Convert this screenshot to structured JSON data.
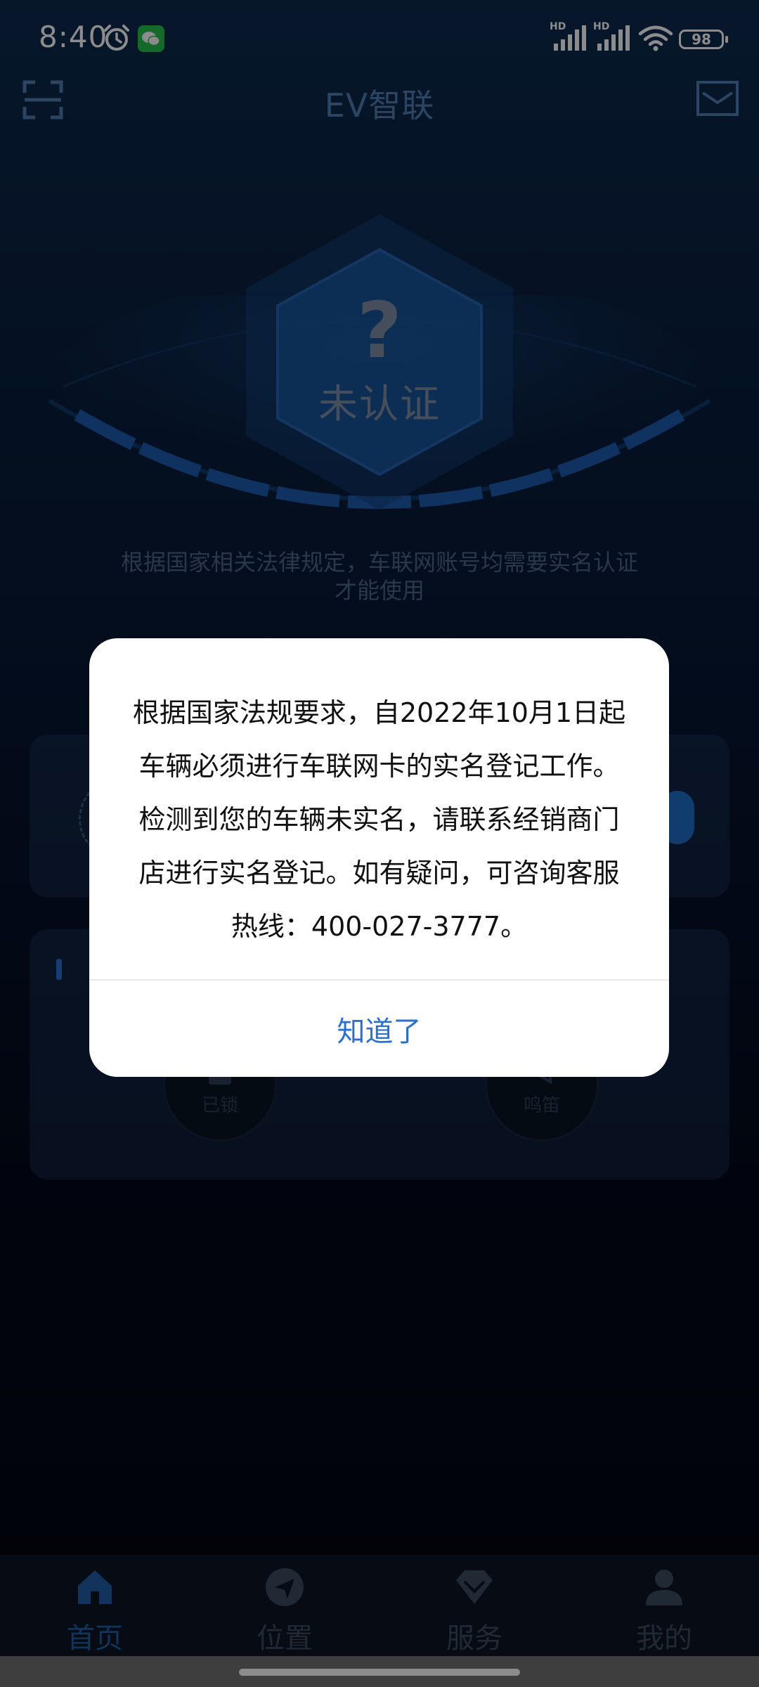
{
  "status_bar": {
    "time": "8:40",
    "hd1": "HD",
    "hd2": "HD",
    "battery": "98"
  },
  "header": {
    "title": "EV智联"
  },
  "hero": {
    "question_mark": "?",
    "status_label": "未认证",
    "notice_line1": "根据国家相关法律规定，车联网账号均需要实名认证",
    "notice_line2": "才能使用"
  },
  "control_card": {
    "lock_label": "已锁",
    "horn_label": "鸣笛"
  },
  "dialog": {
    "message": "根据国家法规要求，自2022年10月1日起车辆必须进行车联网卡的实名登记工作。检测到您的车辆未实名，请联系经销商门店进行实名登记。如有疑问，可咨询客服热线：400-027-3777。",
    "confirm_label": "知道了"
  },
  "bottom_nav": {
    "items": [
      {
        "label": "首页",
        "icon": "home-icon",
        "active": true
      },
      {
        "label": "位置",
        "icon": "location-icon",
        "active": false
      },
      {
        "label": "服务",
        "icon": "diamond-icon",
        "active": false
      },
      {
        "label": "我的",
        "icon": "user-icon",
        "active": false
      }
    ]
  },
  "colors": {
    "accent": "#2a6fd0",
    "background_top": "#0d2a4e",
    "background_bottom": "#02060f"
  }
}
